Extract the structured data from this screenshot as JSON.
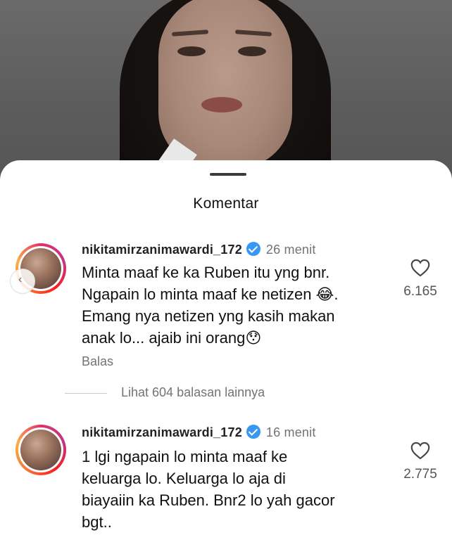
{
  "sheet": {
    "title": "Komentar"
  },
  "comments": [
    {
      "username": "nikitamirzanimawardi_172",
      "time": "26 menit",
      "lines": [
        "Minta maaf ke ka Ruben itu yng bnr.",
        "Ngapain lo minta maaf ke netizen 😂.",
        "Emang nya netizen yng kasih makan",
        "anak lo... ajaib ini orang😯"
      ],
      "reply_label": "Balas",
      "likes": "6.165"
    },
    {
      "username": "nikitamirzanimawardi_172",
      "time": "16 menit",
      "lines": [
        "1 lgi ngapain lo minta maaf ke",
        "keluarga lo. Keluarga lo aja di",
        "biayaiin ka Ruben. Bnr2 lo yah gacor",
        "bgt.."
      ],
      "likes": "2.775"
    }
  ],
  "more_replies": "Lihat 604 balasan lainnya",
  "colors": {
    "verified": "#3897f0",
    "story_ring": "#e1306c",
    "muted_text": "#737373"
  },
  "icons": [
    "verified-badge-icon",
    "heart-icon",
    "story-nav-icon"
  ]
}
